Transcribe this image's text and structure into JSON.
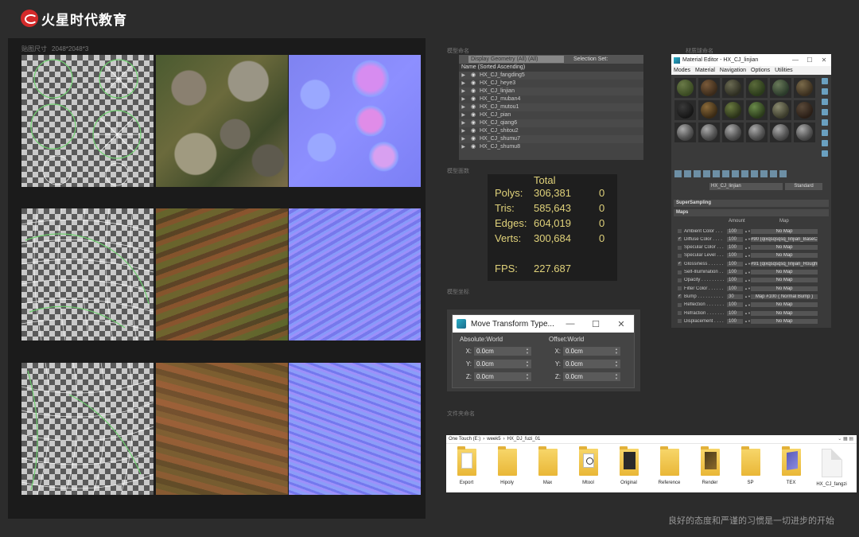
{
  "brand": {
    "name": "火星时代教育"
  },
  "textures": {
    "label": "贴图尺寸",
    "size": "2048*2048*3"
  },
  "sections": {
    "naming": "模型命名",
    "faces": "模型面数",
    "coords": "模型坐标",
    "material_balls": "材质球命名",
    "file_naming": "文件夹命名"
  },
  "scene_explorer": {
    "dropdown": "Display Geometry (All) (All)",
    "selection_set": "Selection Set:",
    "column_header": "Name (Sorted Ascending)",
    "rows": [
      "HX_CJ_fangding5",
      "HX_CJ_heye3",
      "HX_CJ_linjian",
      "HX_CJ_muban4",
      "HX_CJ_mutou1",
      "HX_CJ_pian",
      "HX_CJ_qiang6",
      "HX_CJ_shitou2",
      "HX_CJ_shumu7",
      "HX_CJ_shumu8"
    ]
  },
  "stats": {
    "title": "Total",
    "rows": [
      {
        "label": "Polys:",
        "value": "306,381",
        "sel": "0"
      },
      {
        "label": "Tris:",
        "value": "585,643",
        "sel": "0"
      },
      {
        "label": "Edges:",
        "value": "604,019",
        "sel": "0"
      },
      {
        "label": "Verts:",
        "value": "300,684",
        "sel": "0"
      }
    ],
    "fps_label": "FPS:",
    "fps_value": "227.687"
  },
  "move_transform": {
    "title": "Move Transform Type...",
    "absolute": {
      "title": "Absolute:World",
      "fields": [
        {
          "axis": "X:",
          "value": "0.0cm"
        },
        {
          "axis": "Y:",
          "value": "0.0cm"
        },
        {
          "axis": "Z:",
          "value": "0.0cm"
        }
      ]
    },
    "offset": {
      "title": "Offset:World",
      "fields": [
        {
          "axis": "X:",
          "value": "0.0cm"
        },
        {
          "axis": "Y:",
          "value": "0.0cm"
        },
        {
          "axis": "Z:",
          "value": "0.0cm"
        }
      ]
    },
    "window_buttons": {
      "minimize": "—",
      "maximize": "☐",
      "close": "✕"
    }
  },
  "material_editor": {
    "title": "Material Editor - HX_CJ_linjian",
    "menu": [
      "Modes",
      "Material",
      "Navigation",
      "Options",
      "Utilities"
    ],
    "material_name": "HX_CJ_linjian",
    "shader": "Standard",
    "rollups": {
      "supersampling": "SuperSampling",
      "maps": "Maps"
    },
    "maps_header": {
      "amount": "Amount",
      "map": "Map"
    },
    "maps": [
      {
        "name": "Ambient Color . . . . . .",
        "amount": "100",
        "map": "No Map",
        "checked": false
      },
      {
        "name": "Diffuse Color . . . . . .",
        "amount": "100",
        "map": "#90 (qixqsqsqsq_linjian_BaseColor",
        "checked": true
      },
      {
        "name": "Specular Color . . . . .",
        "amount": "100",
        "map": "No Map",
        "checked": false
      },
      {
        "name": "Specular Level . . . . .",
        "amount": "100",
        "map": "No Map",
        "checked": false
      },
      {
        "name": "Glossiness . . . . . . .",
        "amount": "100",
        "map": "#91 (qixqsqsqsq_linjian_Roughness",
        "checked": true
      },
      {
        "name": "Self-Illumination . . . .",
        "amount": "100",
        "map": "No Map",
        "checked": false
      },
      {
        "name": "Opacity . . . . . . . . .",
        "amount": "100",
        "map": "No Map",
        "checked": false
      },
      {
        "name": "Filter Color . . . . . .",
        "amount": "100",
        "map": "No Map",
        "checked": false
      },
      {
        "name": "Bump . . . . . . . . . .",
        "amount": "30",
        "map": "Map #100 ( Normal Bump )",
        "checked": true
      },
      {
        "name": "Reflection . . . . . . .",
        "amount": "100",
        "map": "No Map",
        "checked": false
      },
      {
        "name": "Refraction . . . . . . .",
        "amount": "100",
        "map": "No Map",
        "checked": false
      },
      {
        "name": "Displacement . . . . . .",
        "amount": "100",
        "map": "No Map",
        "checked": false
      }
    ],
    "window_buttons": {
      "minimize": "—",
      "maximize": "☐",
      "close": "✕"
    }
  },
  "file_browser": {
    "breadcrumb": [
      "One Touch (E:)",
      "›",
      "week5",
      "›",
      "HX_DJ_fuzi_01"
    ],
    "items": [
      {
        "name": "Export",
        "kind": "doc"
      },
      {
        "name": "Hipoly",
        "kind": "plain"
      },
      {
        "name": "Max",
        "kind": "plain"
      },
      {
        "name": "Mtool",
        "kind": "circ"
      },
      {
        "name": "Original",
        "kind": "dark"
      },
      {
        "name": "Reference",
        "kind": "plain"
      },
      {
        "name": "Render",
        "kind": "brown"
      },
      {
        "name": "SP",
        "kind": "plain"
      },
      {
        "name": "TEX",
        "kind": "purple"
      },
      {
        "name": "HX_CJ_fangzi",
        "kind": "file"
      }
    ]
  },
  "slogan": "良好的态度和严谨的习惯是一切进步的开始"
}
